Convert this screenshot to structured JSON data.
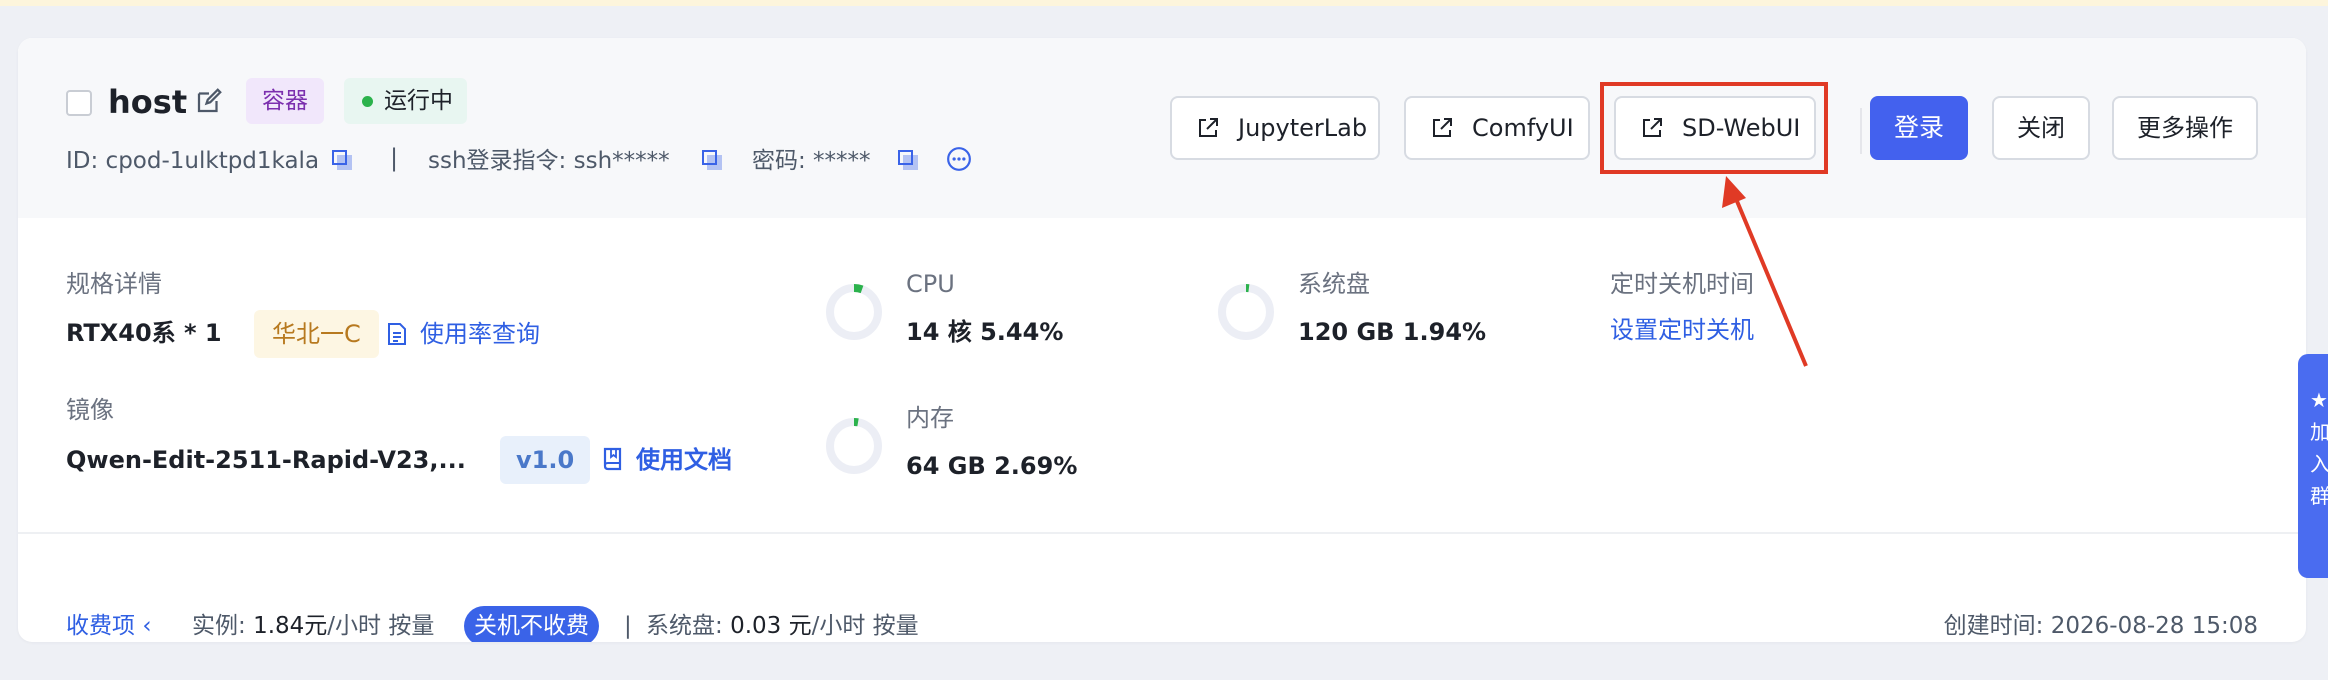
{
  "header": {
    "name": "host",
    "type_tag": "容器",
    "status": "运行中",
    "id_label": "ID: cpod-1ulktpd1kala",
    "separator": "|",
    "ssh_label": "ssh登录指令: ssh*****",
    "password_label": "密码: *****"
  },
  "toolbar": {
    "jupyterlab": "JupyterLab",
    "comfyui": "ComfyUI",
    "sdwebui": "SD-WebUI",
    "login": "登录",
    "close": "关闭",
    "more": "更多操作"
  },
  "specs": {
    "spec_label": "规格详情",
    "spec_value": "RTX40系 * 1",
    "region": "华北一C",
    "usage_link": "使用率查询",
    "image_label": "镜像",
    "image_value": "Qwen-Edit-2511-Rapid-V23,...",
    "version": "v1.0",
    "docs_link": "使用文档"
  },
  "metrics": {
    "cpu_label": "CPU",
    "cpu_value": "14 核 5.44%",
    "cpu_usage": 5.44,
    "mem_label": "内存",
    "mem_value": "64 GB 2.69%",
    "mem_usage": 2.69,
    "disk_label": "系统盘",
    "disk_value": "120 GB 1.94%",
    "disk_usage": 1.94
  },
  "schedule": {
    "label": "定时关机时间",
    "link": "设置定时关机"
  },
  "billing": {
    "label": "收费项",
    "instance_label": "实例:",
    "instance_price": "1.84元",
    "instance_unit": "/小时 按量",
    "badge": "关机不收费",
    "separator": "|",
    "disk_label": "系统盘:",
    "disk_price": "0.03 元",
    "disk_unit": "/小时 按量",
    "created": "创建时间: 2026-08-28 15:08"
  },
  "side_tab": {
    "text": "★加入群"
  },
  "colors": {
    "primary": "#4361ee",
    "highlight": "#e03a25",
    "running_dot": "#2bb24c"
  }
}
